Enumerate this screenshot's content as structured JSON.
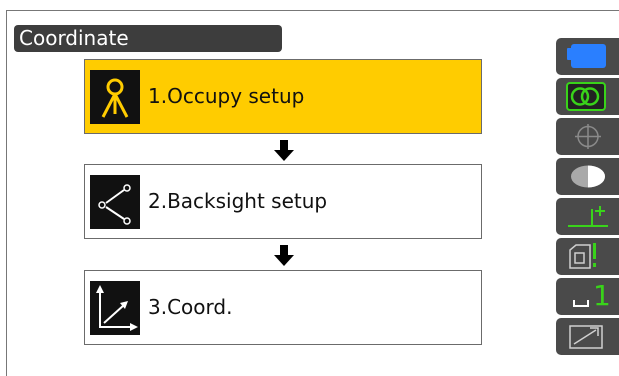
{
  "screen": {
    "title": "Coordinate"
  },
  "steps": [
    {
      "label": "1.Occupy setup",
      "icon": "tripod-icon",
      "selected": true
    },
    {
      "label": "2.Backsight setup",
      "icon": "backsight-icon",
      "selected": false
    },
    {
      "label": "3.Coord.",
      "icon": "coordinate-axes-icon",
      "selected": false
    }
  ],
  "status_bar": {
    "icons": [
      "battery-icon",
      "tilt-compensation-icon",
      "target-icon",
      "laser-icon",
      "prism-constant-icon",
      "measure-mode-icon",
      "input-mode-icon",
      "keyboard-icon"
    ],
    "input_mode_text": "1"
  },
  "colors": {
    "selected": "#ffcc00",
    "title_bg": "#3d3d3d",
    "battery": "#2a7fff",
    "accent_green": "#39d31a"
  }
}
